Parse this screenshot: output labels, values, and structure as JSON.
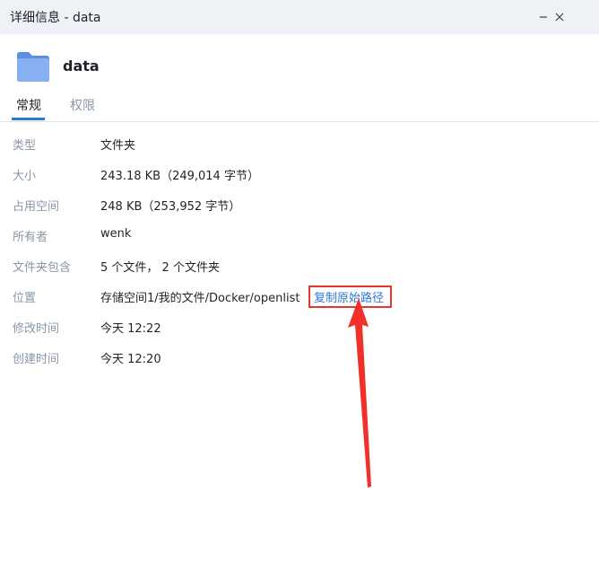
{
  "window": {
    "title": "详细信息 - data"
  },
  "header": {
    "name": "data"
  },
  "tabs": [
    {
      "label": "常规"
    },
    {
      "label": "权限"
    }
  ],
  "properties": [
    {
      "label": "类型",
      "value": "文件夹"
    },
    {
      "label": "大小",
      "value": "243.18 KB（249,014 字节）"
    },
    {
      "label": "占用空间",
      "value": "248 KB（253,952 字节）"
    },
    {
      "label": "所有者",
      "value": "wenk"
    },
    {
      "label": "文件夹包含",
      "value": "5 个文件， 2 个文件夹"
    },
    {
      "label": "位置",
      "value": "存储空间1/我的文件/Docker/openlist"
    },
    {
      "label": "修改时间",
      "value": "今天 12:22"
    },
    {
      "label": "创建时间",
      "value": "今天 12:20"
    }
  ],
  "location_action": {
    "label": "复制原始路径"
  },
  "icons": {
    "minimize": "minimize-icon",
    "close": "close-icon",
    "folder": "folder-icon"
  },
  "colors": {
    "accent": "#2d7ad6",
    "highlight_box": "#e53a2b",
    "arrow": "#f0302a",
    "titlebar_bg": "#eef2f7",
    "label_text": "#8a96a6"
  }
}
